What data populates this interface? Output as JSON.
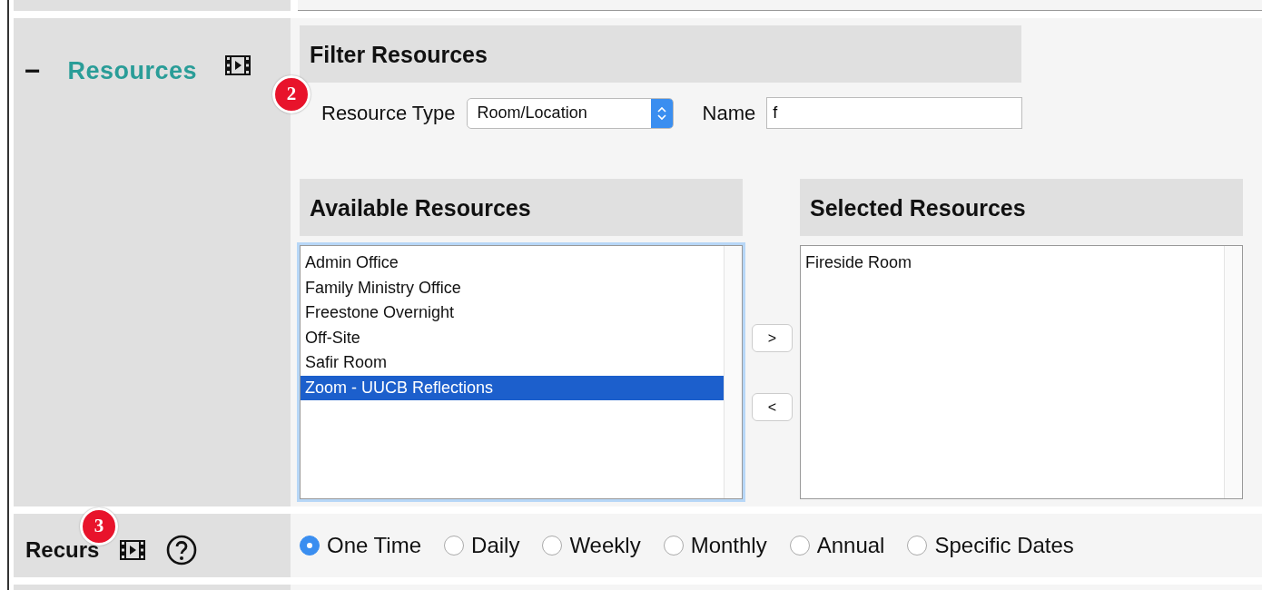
{
  "resources_section": {
    "toggle": "−",
    "title": "Resources",
    "badge": "2"
  },
  "filter": {
    "title": "Filter Resources",
    "resource_type": {
      "label": "Resource Type",
      "value": "Room/Location"
    },
    "name": {
      "label": "Name",
      "value": "f"
    }
  },
  "available": {
    "title": "Available Resources",
    "items": [
      {
        "label": "Admin Office",
        "selected": false
      },
      {
        "label": "Family Ministry Office",
        "selected": false
      },
      {
        "label": "Freestone Overnight",
        "selected": false
      },
      {
        "label": "Off-Site",
        "selected": false
      },
      {
        "label": "Safir Room",
        "selected": false
      },
      {
        "label": "Zoom - UUCB Reflections",
        "selected": true
      }
    ]
  },
  "move_buttons": [
    ">",
    "<"
  ],
  "chosen": {
    "title": "Selected Resources",
    "items": [
      {
        "label": "Fireside Room",
        "selected": false
      }
    ]
  },
  "recurs": {
    "label": "Recurs",
    "badge": "3",
    "options": [
      {
        "label": "One Time",
        "selected": true
      },
      {
        "label": "Daily",
        "selected": false
      },
      {
        "label": "Weekly",
        "selected": false
      },
      {
        "label": "Monthly",
        "selected": false
      },
      {
        "label": "Annual",
        "selected": false
      },
      {
        "label": "Specific Dates",
        "selected": false
      }
    ]
  }
}
